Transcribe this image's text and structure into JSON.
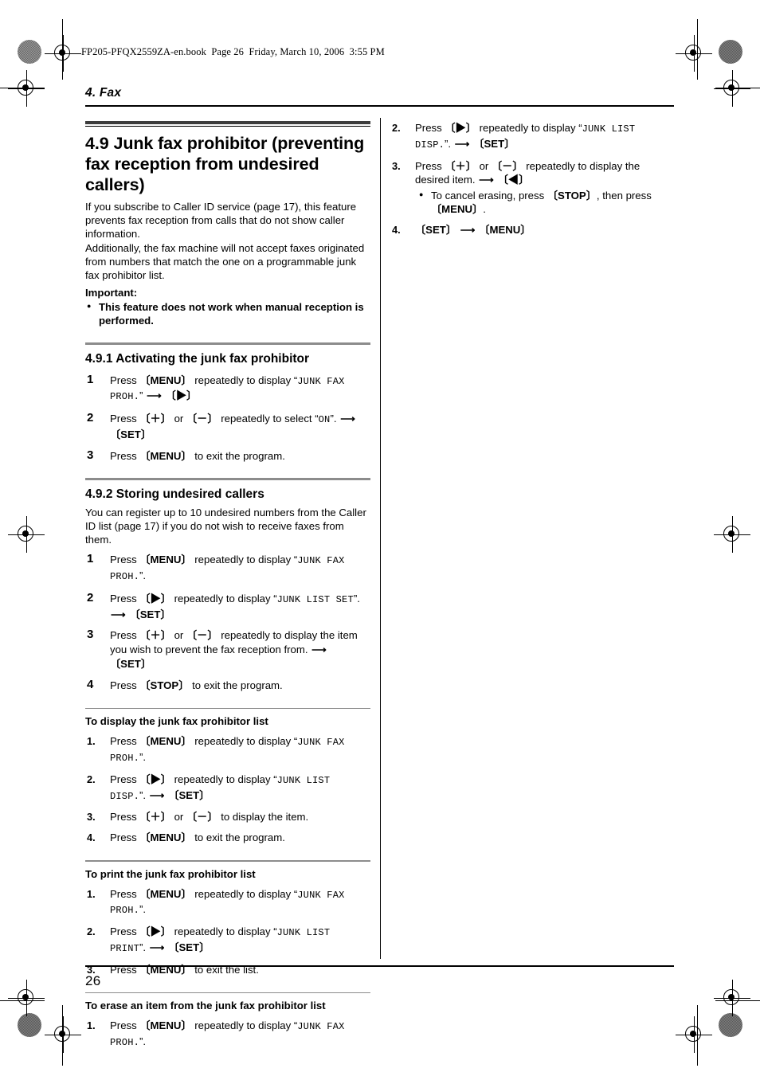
{
  "book_header": "FP205-PFQX2559ZA-en.book  Page 26  Friday, March 10, 2006  3:55 PM",
  "chapter": {
    "title": "4. Fax"
  },
  "footer": {
    "page_number": "26"
  },
  "keys": {
    "menu": "〔MENU〕",
    "set": "〔SET〕",
    "stop": "〔STOP〕",
    "right": "〔▶〕",
    "left": "〔◀〕",
    "plus": "〔＋〕",
    "minus": "〔－〕",
    "arrow": "⟶"
  },
  "lcd": {
    "junk_fax_proh": "JUNK FAX PROH.",
    "on": "ON",
    "junk_list_set": "JUNK LIST SET",
    "junk_list_disp": "JUNK LIST DISP.",
    "junk_list_print": "JUNK LIST PRINT"
  },
  "section": {
    "title": "4.9 Junk fax prohibitor (preventing fax reception from undesired callers)",
    "intro_1": "If you subscribe to Caller ID service (page 17), this feature prevents fax reception from calls that do not show caller information.",
    "intro_2": "Additionally, the fax machine will not accept faxes originated from numbers that match the one on a programmable junk fax prohibitor list.",
    "important_label": "Important:",
    "important_bullet": "This feature does not work when manual reception is performed."
  },
  "subsection_491": {
    "title": "4.9.1 Activating the junk fax prohibitor",
    "steps": [
      {
        "num": "1",
        "pre": "Press ",
        "key1": "〔MENU〕",
        "mid": " repeatedly to display “",
        "lcd": "JUNK FAX PROH.",
        "post": "” ",
        "arrow": "⟶",
        "key2": "〔▶〕",
        "tail": ""
      },
      {
        "num": "2",
        "pre": "Press ",
        "key1": "〔＋〕",
        "mid": " or ",
        "key1b": "〔－〕",
        "mid2": " repeatedly to select “",
        "lcd": "ON",
        "post": "”. ",
        "arrow": "⟶",
        "key2": "〔SET〕",
        "tail": ""
      },
      {
        "num": "3",
        "pre": "Press ",
        "key1": "〔MENU〕",
        "mid": " to exit the program.",
        "tail": ""
      }
    ]
  },
  "subsection_492": {
    "title": "4.9.2 Storing undesired callers",
    "intro": "You can register up to 10 undesired numbers from the Caller ID list (page 17) if you do not wish to receive faxes from them.",
    "steps": [
      {
        "num": "1",
        "text_pre": "Press ",
        "key1": "〔MENU〕",
        "text_mid": " repeatedly to display “",
        "lcd": "JUNK FAX PROH.",
        "text_post": "”."
      },
      {
        "num": "2",
        "text_pre": "Press ",
        "key1": "〔▶〕",
        "text_mid": " repeatedly to display “",
        "lcd": "JUNK LIST SET",
        "text_post": "”. ",
        "arrow": "⟶",
        "key2": "〔SET〕"
      },
      {
        "num": "3",
        "text_pre": "Press ",
        "key1": "〔＋〕",
        "text_mid0": " or ",
        "key1b": "〔－〕",
        "text_mid": " repeatedly to display the item you wish to prevent the fax reception from. ",
        "arrow": "⟶",
        "key2": "〔SET〕"
      },
      {
        "num": "4",
        "text_pre": "Press ",
        "key1": "〔STOP〕",
        "text_mid": " to exit the program."
      }
    ]
  },
  "display_list": {
    "title": "To display the junk fax prohibitor list",
    "steps": [
      {
        "num": "1.",
        "pre": "Press ",
        "k1": "〔MENU〕",
        "mid": " repeatedly to display “",
        "lcd": "JUNK FAX PROH.",
        "post": "”."
      },
      {
        "num": "2.",
        "pre": "Press ",
        "k1": "〔▶〕",
        "mid": " repeatedly to display “",
        "lcd": "JUNK LIST DISP.",
        "post": "”. ",
        "arrow": "⟶",
        "k2": "〔SET〕"
      },
      {
        "num": "3.",
        "pre": "Press ",
        "k1": "〔＋〕",
        "mid0": " or ",
        "k1b": "〔－〕",
        "mid": " to display the item."
      },
      {
        "num": "4.",
        "pre": "Press ",
        "k1": "〔MENU〕",
        "mid": " to exit the program."
      }
    ]
  },
  "print_list": {
    "title": "To print the junk fax prohibitor list",
    "steps": [
      {
        "num": "1.",
        "pre": "Press ",
        "k1": "〔MENU〕",
        "mid": " repeatedly to display “",
        "lcd": "JUNK FAX PROH.",
        "post": "”."
      },
      {
        "num": "2.",
        "pre": "Press ",
        "k1": "〔▶〕",
        "mid": " repeatedly to display “",
        "lcd": "JUNK LIST PRINT",
        "post": "”. ",
        "arrow": "⟶",
        "k2": "〔SET〕"
      },
      {
        "num": "3.",
        "pre": "Press ",
        "k1": "〔MENU〕",
        "mid": " to exit the list."
      }
    ]
  },
  "erase_item": {
    "title": "To erase an item from the junk fax prohibitor list",
    "steps": [
      {
        "num": "1.",
        "pre": "Press ",
        "k1": "〔MENU〕",
        "mid": " repeatedly to display “",
        "lcd": "JUNK FAX PROH.",
        "post": "”."
      },
      {
        "num": "2.",
        "pre": "Press ",
        "k1": "〔▶〕",
        "mid": " repeatedly to display “",
        "lcd": "JUNK LIST DISP.",
        "post": "”. ",
        "arrow": "⟶",
        "k2": "〔SET〕"
      },
      {
        "num": "3.",
        "pre": "Press ",
        "k1": "〔＋〕",
        "mid0": " or ",
        "k1b": "〔－〕",
        "mid": " repeatedly to display the desired item. ",
        "arrow": "⟶",
        "k2": "〔◀〕",
        "bullet_pre": "To cancel erasing, press ",
        "bullet_k1": "〔STOP〕",
        "bullet_mid": ", then press ",
        "bullet_k2": "〔MENU〕",
        "bullet_post": "."
      },
      {
        "num": "4.",
        "k1": "〔SET〕",
        "arrow": "⟶",
        "k2": "〔MENU〕"
      }
    ]
  }
}
